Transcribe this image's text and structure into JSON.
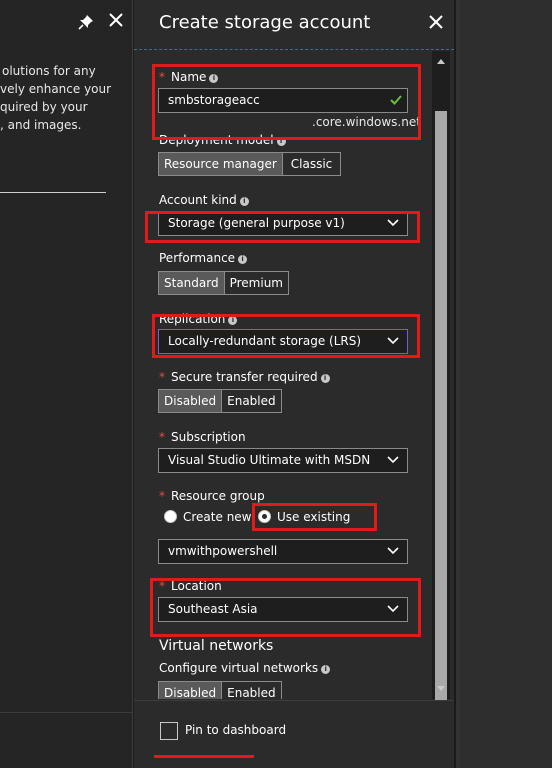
{
  "left_blade": {
    "text_lines": [
      "olutions for any",
      "vely enhance your",
      "quired by your",
      ", and images."
    ]
  },
  "blade": {
    "title": "Create storage account",
    "name": {
      "label": "Name",
      "value": "smbstorageacc",
      "suffix": ".core.windows.net"
    },
    "deployment_model": {
      "label": "Deployment model",
      "options": [
        "Resource manager",
        "Classic"
      ],
      "selected": "Resource manager"
    },
    "account_kind": {
      "label": "Account kind",
      "value": "Storage (general purpose v1)"
    },
    "performance": {
      "label": "Performance",
      "options": [
        "Standard",
        "Premium"
      ],
      "selected": "Standard"
    },
    "replication": {
      "label": "Replication",
      "value": "Locally-redundant storage (LRS)"
    },
    "secure_transfer": {
      "label": "Secure transfer required",
      "options": [
        "Disabled",
        "Enabled"
      ],
      "selected": "Disabled"
    },
    "subscription": {
      "label": "Subscription",
      "value": "Visual Studio Ultimate with MSDN"
    },
    "resource_group": {
      "label": "Resource group",
      "create_new": "Create new",
      "use_existing": "Use existing",
      "selected": "Use existing",
      "value": "vmwithpowershell"
    },
    "location": {
      "label": "Location",
      "value": "Southeast Asia"
    },
    "virtual_networks": {
      "section_title": "Virtual networks",
      "label": "Configure virtual networks",
      "options": [
        "Disabled",
        "Enabled"
      ],
      "selected": "Disabled"
    },
    "footer": {
      "pin_label": "Pin to dashboard"
    }
  },
  "colors": {
    "highlight": "#e21a1a",
    "required": "#e74c3c",
    "check": "#6bbf3a",
    "focus": "#7a5fc2"
  }
}
